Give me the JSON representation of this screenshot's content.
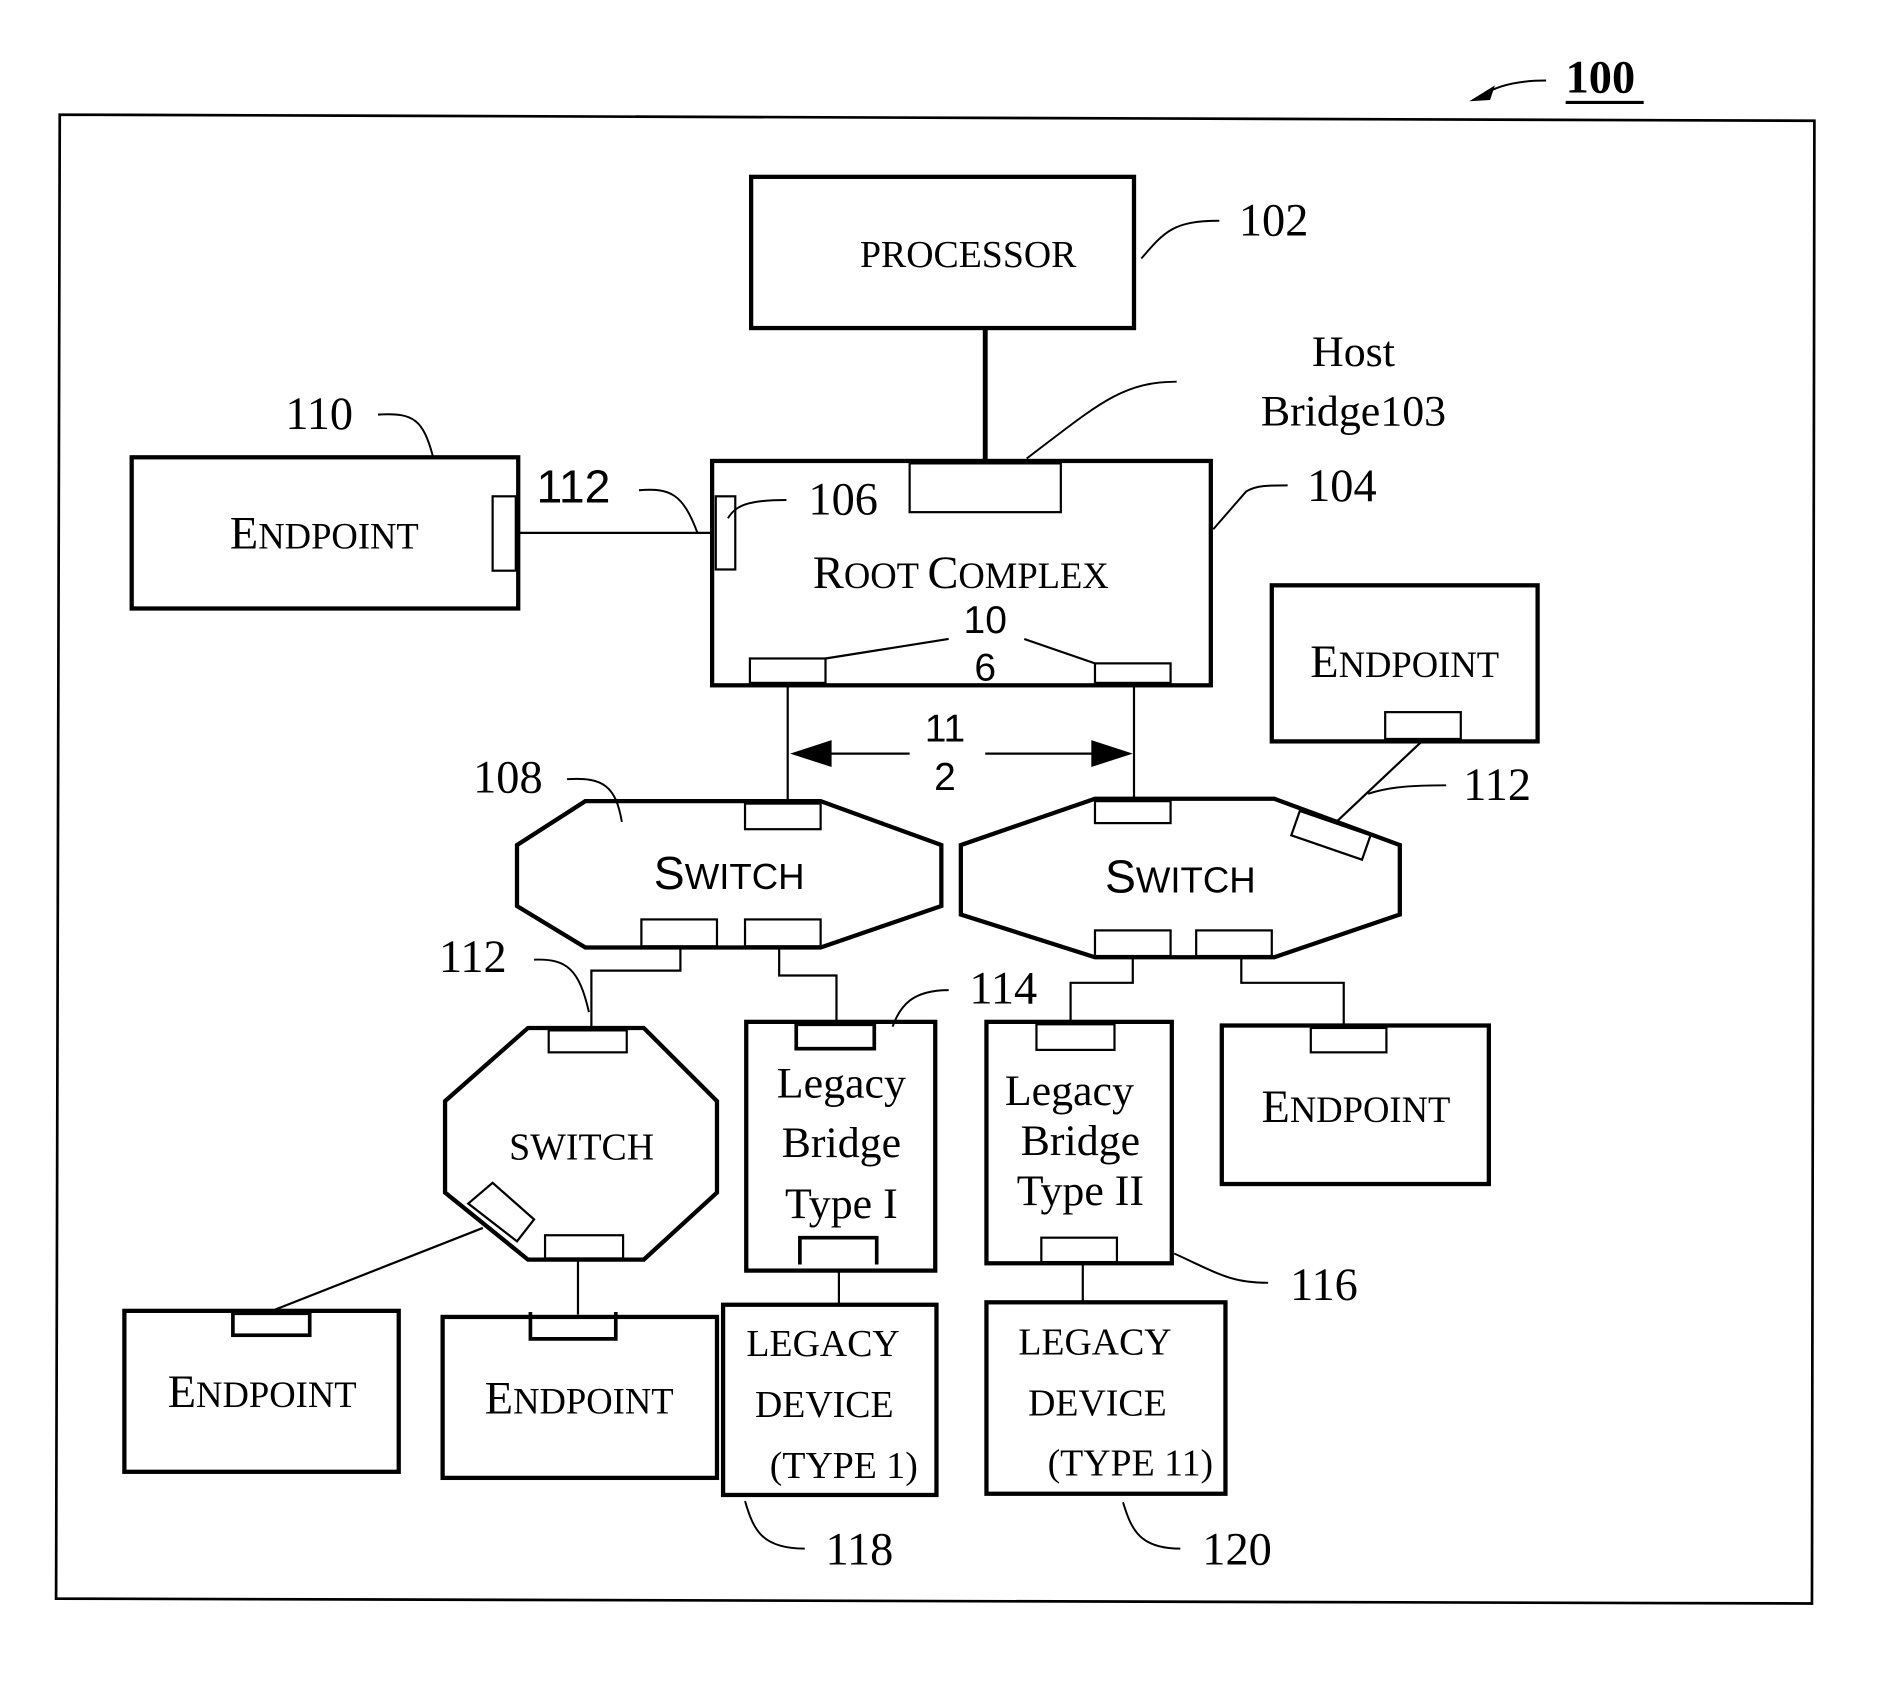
{
  "figure": {
    "figure_ref": "100",
    "nodes": {
      "processor": {
        "label": "PROCESSOR",
        "ref": "102"
      },
      "host_bridge": {
        "label_line1": "Host",
        "label_line2": "Bridge103"
      },
      "root_complex": {
        "label_first": "R",
        "label_first_rest": "OOT ",
        "label_second": "C",
        "label_second_rest": "OMPLEX",
        "ref": "104",
        "port_ref": "106",
        "internal_ref_line1": "10",
        "internal_ref_line2": "6"
      },
      "endpoint_left": {
        "label_first": "E",
        "label_rest": "NDPOINT",
        "ref": "110"
      },
      "link_left": {
        "ref": "112"
      },
      "link_between": {
        "ref_line1": "11",
        "ref_line2": "2"
      },
      "switch_left": {
        "label_first": "S",
        "label_rest": "WITCH",
        "ref": "108"
      },
      "switch_right": {
        "label_first": "S",
        "label_rest": "WITCH"
      },
      "endpoint_upper_right": {
        "label_first": "E",
        "label_rest": "NDPOINT"
      },
      "link_upper_right": {
        "ref": "112"
      },
      "link_lower_left": {
        "ref": "112"
      },
      "switch_lower": {
        "label": "SWITCH"
      },
      "legacy_bridge_1": {
        "line1": "Legacy",
        "line2": "Bridge",
        "line3": "Type I",
        "ref": "114"
      },
      "legacy_bridge_2": {
        "line1": "Legacy",
        "line2": "Bridge",
        "line3": "Type II",
        "ref": "116"
      },
      "endpoint_mid_right": {
        "label_first": "E",
        "label_rest": "NDPOINT"
      },
      "endpoint_bottom_1": {
        "label_first": "E",
        "label_rest": "NDPOINT"
      },
      "endpoint_bottom_2": {
        "label_first": "E",
        "label_rest": "NDPOINT"
      },
      "legacy_device_1": {
        "line1": "LEGACY",
        "line2": "DEVICE",
        "line3": "(TYPE 1)",
        "ref": "118"
      },
      "legacy_device_2": {
        "line1": "LEGACY",
        "line2": "DEVICE",
        "line3": "(TYPE 11)",
        "ref": "120"
      }
    }
  }
}
